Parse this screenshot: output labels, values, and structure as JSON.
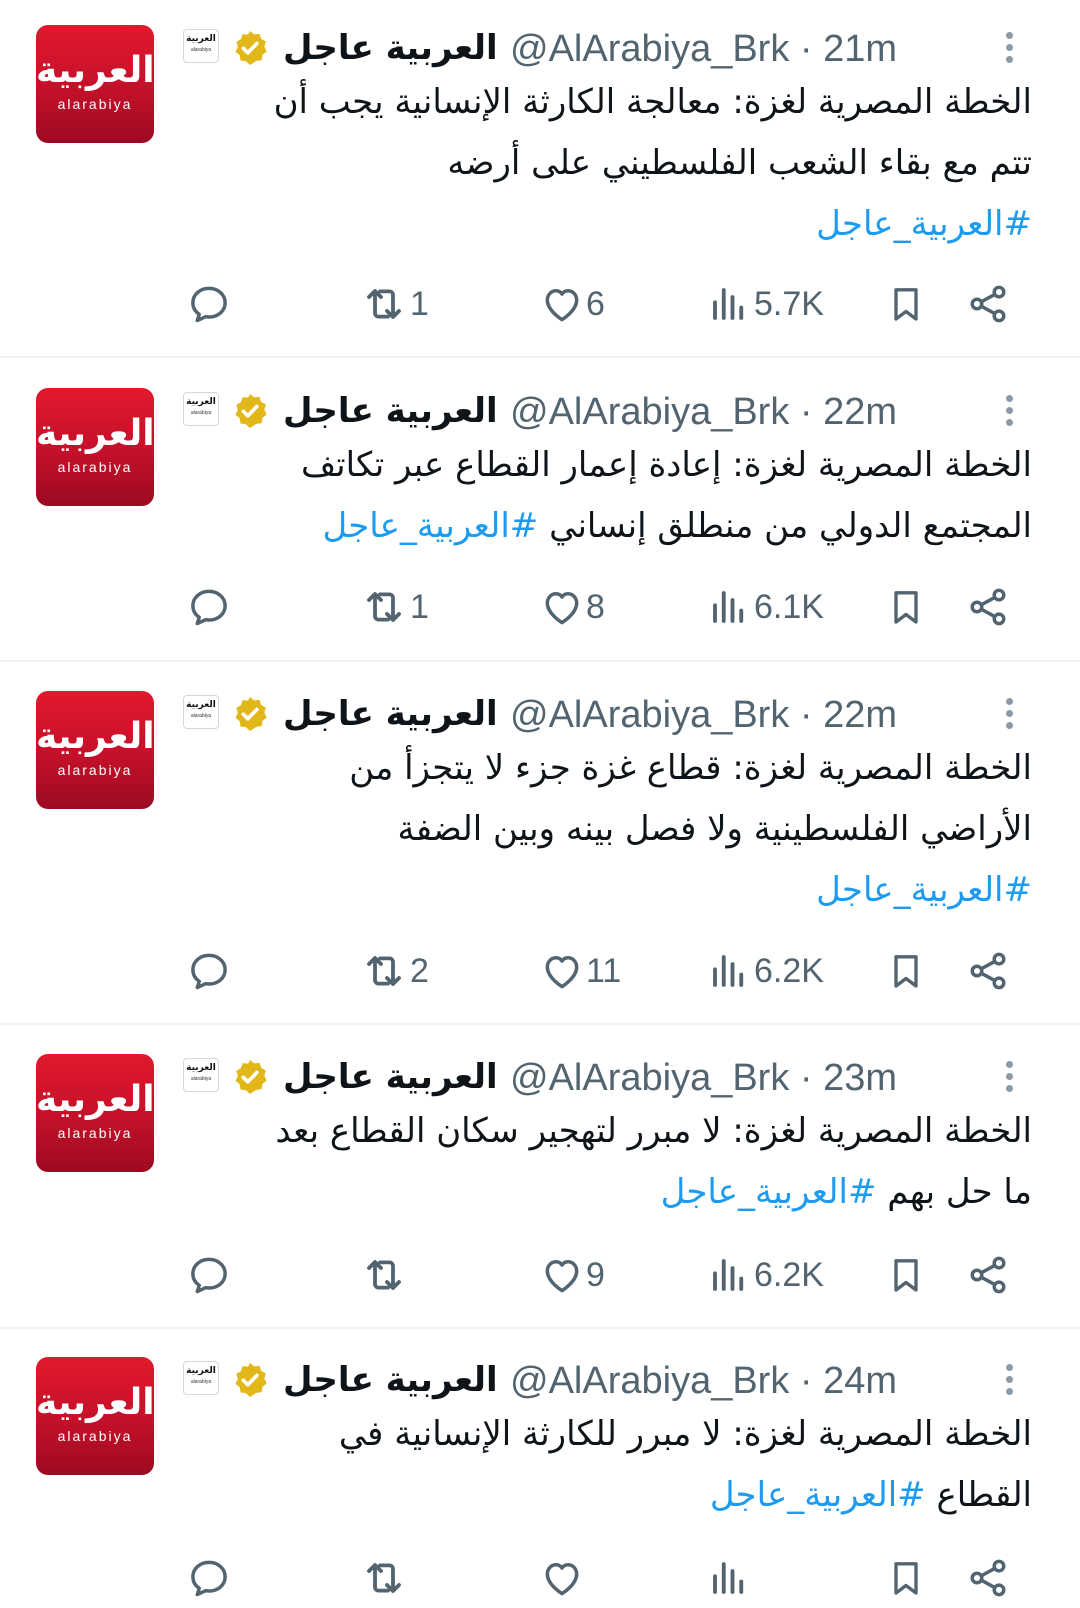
{
  "account": {
    "name": "العربية عاجل",
    "handle": "@AlArabiya_Brk",
    "avatar_text_ar": "العربية",
    "avatar_text_en": "alarabiya"
  },
  "colors": {
    "brand_red": "#d7182a",
    "link_blue": "#1d9bf0",
    "muted_gray": "#536471",
    "verified_gold": "#e2b719"
  },
  "tweets": [
    {
      "time": "· 21m",
      "lines": [
        "الخطة المصرية لغزة: معالجة الكارثة الإنسانية يجب أن",
        "تتم مع بقاء الشعب الفلسطيني على أرضه"
      ],
      "hashtag": "#العربية_عاجل",
      "retweets": "1",
      "likes": "6",
      "views": "5.7K"
    },
    {
      "time": "· 22m",
      "lines": [
        "الخطة المصرية لغزة: إعادة إعمار القطاع عبر تكاتف",
        "المجتمع الدولي من منطلق إنساني"
      ],
      "hashtag": "#العربية_عاجل",
      "retweets": "1",
      "likes": "8",
      "views": "6.1K"
    },
    {
      "time": "· 22m",
      "lines": [
        "الخطة المصرية لغزة: قطاع غزة جزء لا يتجزأ من",
        "الأراضي الفلسطينية ولا فصل بينه وبين الضفة"
      ],
      "hashtag": "#العربية_عاجل",
      "retweets": "2",
      "likes": "11",
      "views": "6.2K"
    },
    {
      "time": "· 23m",
      "lines": [
        "الخطة المصرية لغزة: لا مبرر لتهجير سكان القطاع بعد",
        "ما حل بهم"
      ],
      "hashtag": "#العربية_عاجل",
      "retweets": "",
      "likes": "9",
      "views": "6.2K"
    },
    {
      "time": "· 24m",
      "lines": [
        "الخطة المصرية لغزة: لا مبرر للكارثة الإنسانية في",
        "القطاع"
      ],
      "hashtag": "#العربية_عاجل",
      "retweets": "",
      "likes": "",
      "views": ""
    }
  ],
  "icons": {
    "reply": "reply-icon",
    "retweet": "retweet-icon",
    "like": "heart-icon",
    "views": "views-icon",
    "bookmark": "bookmark-icon",
    "share": "share-icon",
    "more": "more-icon",
    "verified": "verified-badge-icon"
  }
}
